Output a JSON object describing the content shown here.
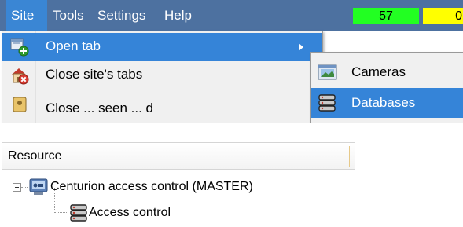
{
  "menubar": {
    "items": [
      {
        "label": "Site",
        "active": true
      },
      {
        "label": "Tools",
        "active": false
      },
      {
        "label": "Settings",
        "active": false
      },
      {
        "label": "Help",
        "active": false
      }
    ],
    "counters": [
      {
        "value": "57",
        "color": "#22ff22"
      },
      {
        "value": "0",
        "color": "#ffff00"
      }
    ]
  },
  "site_menu": {
    "items": [
      {
        "label": "Open tab",
        "icon": "open-tab-icon",
        "highlighted": true,
        "has_submenu": true
      },
      {
        "label": "Close site's tabs",
        "icon": "close-tabs-icon",
        "highlighted": false
      },
      {
        "label": "Close ... seen ... d",
        "icon": "close-icon",
        "highlighted": false
      }
    ]
  },
  "open_tab_submenu": {
    "items": [
      {
        "label": "Cameras",
        "icon": "cameras-icon",
        "highlighted": false
      },
      {
        "label": "Databases",
        "icon": "database-icon",
        "highlighted": true
      }
    ]
  },
  "resource_tree": {
    "column_header": "Resource",
    "root": {
      "label": "Centurion access control (MASTER)",
      "icon": "server-icon",
      "expanded": true
    },
    "children": [
      {
        "label": "Access control",
        "icon": "database-icon"
      }
    ]
  }
}
